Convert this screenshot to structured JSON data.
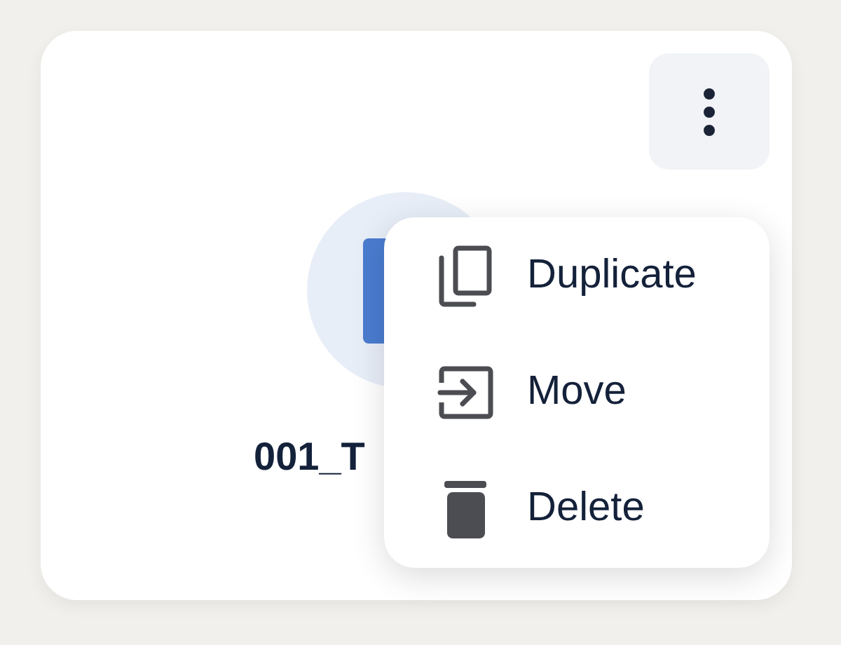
{
  "card": {
    "title": "001_T"
  },
  "menu": {
    "items": [
      {
        "kind": "duplicate",
        "label": "Duplicate"
      },
      {
        "kind": "move",
        "label": "Move"
      },
      {
        "kind": "delete",
        "label": "Delete"
      }
    ]
  }
}
